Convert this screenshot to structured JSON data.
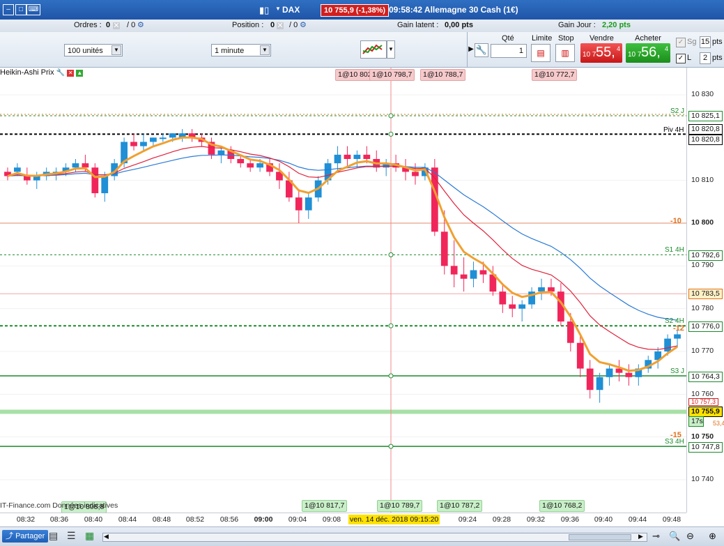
{
  "titlebar": {
    "instrument": "DAX",
    "price_badge": "10 755,9 (-1,38%)",
    "title": "09:58:42 Allemagne 30 Cash (1€)"
  },
  "statusbar": {
    "orders_label": "Ordres :",
    "orders_value": "0",
    "orders_sep": "/ 0",
    "position_label": "Position :",
    "position_value": "0",
    "position_sep": "/ 0",
    "gain_latent_label": "Gain latent :",
    "gain_latent_value": "0,00 pts",
    "gain_jour_label": "Gain Jour :",
    "gain_jour_value": "2,20 pts"
  },
  "toolbar": {
    "quantity_select": "100 unités",
    "interval_select": "1 minute",
    "qty_label": "Qté",
    "qty_value": "1",
    "limit_label": "Limite",
    "stop_label": "Stop",
    "sell_label": "Vendre",
    "buy_label": "Acheter",
    "sell_small": "10 7",
    "sell_big": "55,",
    "sell_sup": "4",
    "buy_small": "10 7",
    "buy_big": "56,",
    "buy_sup": "4",
    "sg_label": "Sg",
    "sg_value": "15",
    "sg_unit": "pts",
    "l_label": "L",
    "l_value": "2",
    "l_unit": "pts"
  },
  "chart": {
    "indicator_label": "Heikin-Ashi Prix",
    "copyright": "IT-Finance.com Données indicatives",
    "top_tags": [
      "1@10 802",
      "1@10 798,7",
      "1@10 788,7",
      "1@10 772,7"
    ],
    "bottom_tags": [
      "1@10 808,8",
      "1@10 817,7",
      "1@10 789,7",
      "1@10 787,2",
      "1@10 768,2"
    ],
    "right_labels": {
      "s2j": "S2 J",
      "piv4h": "Piv 4H",
      "m10": "-10",
      "s14h": "S1 4H",
      "s24h": "S2 4H",
      "m12": "-12",
      "s3j": "S3 J",
      "m15": "-15",
      "s34h": "S3 4H"
    }
  },
  "yaxis": {
    "ticks": [
      "10 830",
      "10 810",
      "10 800",
      "10 790",
      "10 780",
      "10 770",
      "10 760",
      "10 750",
      "10 740"
    ],
    "tags": [
      "10 825,1",
      "10 820,8",
      "10 820,8",
      "10 792,6",
      "10 783,5",
      "10 776,0",
      "10 764,3",
      "10 757,3",
      "10 755,9",
      "17s",
      "53,4",
      "10 747,8"
    ]
  },
  "xaxis": {
    "ticks": [
      "08:32",
      "08:36",
      "08:40",
      "08:44",
      "08:48",
      "08:52",
      "08:56",
      "09:00",
      "09:04",
      "09:08",
      "09:24",
      "09:28",
      "09:32",
      "09:36",
      "09:40",
      "09:44",
      "09:48"
    ],
    "cursor_label": "ven. 14 déc. 2018 09:15:20"
  },
  "bottombar": {
    "share_label": "Partager"
  },
  "colors": {
    "bull": "#1f8fd6",
    "bear": "#f0265a",
    "accent": "#2a6ad0",
    "resistance": "#c81e2e",
    "support": "#1a8a2a"
  },
  "chart_data": {
    "type": "candlestick",
    "indicator": "Heikin-Ashi Prix",
    "instrument": "DAX",
    "timeframe": "1 minute",
    "ylim": [
      10735,
      10833
    ],
    "x_ticks": [
      "08:32",
      "08:36",
      "08:40",
      "08:44",
      "08:48",
      "08:52",
      "08:56",
      "09:00",
      "09:04",
      "09:08",
      "09:24",
      "09:28",
      "09:32",
      "09:36",
      "09:40",
      "09:44",
      "09:48"
    ],
    "levels": [
      {
        "label": "S2 J",
        "value": 10825.1
      },
      {
        "label": "Piv 4H",
        "value": 10820.8
      },
      {
        "label": "-10",
        "value": 10800
      },
      {
        "label": "S1 4H",
        "value": 10792.6
      },
      {
        "label": "10 783,5",
        "value": 10783.5
      },
      {
        "label": "S2 4H",
        "value": 10776.0
      },
      {
        "label": "S3 J",
        "value": 10764.3
      },
      {
        "label": "10 755,9",
        "value": 10755.9
      },
      {
        "label": "S3 4H",
        "value": 10747.8
      }
    ],
    "candles": [
      [
        10812,
        10813,
        10810,
        10811
      ],
      [
        10812,
        10814,
        10811,
        10813
      ],
      [
        10811,
        10813,
        10809,
        10810
      ],
      [
        10810,
        10812,
        10808,
        10811
      ],
      [
        10811,
        10813,
        10810,
        10812
      ],
      [
        10812,
        10813,
        10810,
        10812
      ],
      [
        10812,
        10814,
        10811,
        10813
      ],
      [
        10813,
        10815,
        10812,
        10814
      ],
      [
        10814,
        10816,
        10812,
        10813
      ],
      [
        10813,
        10814,
        10806,
        10807
      ],
      [
        10807,
        10812,
        10805,
        10811
      ],
      [
        10811,
        10815,
        10810,
        10814
      ],
      [
        10814,
        10820,
        10813,
        10819
      ],
      [
        10819,
        10821,
        10817,
        10818
      ],
      [
        10818,
        10821,
        10817,
        10819
      ],
      [
        10819,
        10820,
        10818,
        10820
      ],
      [
        10820,
        10821,
        10819,
        10820
      ],
      [
        10820,
        10821,
        10819,
        10821
      ],
      [
        10820,
        10822,
        10819,
        10821
      ],
      [
        10821,
        10822,
        10819,
        10820
      ],
      [
        10820,
        10821,
        10818,
        10819
      ],
      [
        10819,
        10820,
        10815,
        10816
      ],
      [
        10816,
        10818,
        10814,
        10817
      ],
      [
        10817,
        10818,
        10814,
        10815
      ],
      [
        10815,
        10816,
        10813,
        10814
      ],
      [
        10814,
        10815,
        10812,
        10813
      ],
      [
        10813,
        10815,
        10812,
        10814
      ],
      [
        10814,
        10815,
        10811,
        10812
      ],
      [
        10812,
        10814,
        10808,
        10810
      ],
      [
        10810,
        10812,
        10805,
        10806
      ],
      [
        10806,
        10808,
        10800,
        10803
      ],
      [
        10803,
        10807,
        10801,
        10806
      ],
      [
        10806,
        10811,
        10805,
        10810
      ],
      [
        10810,
        10815,
        10809,
        10814
      ],
      [
        10814,
        10818,
        10812,
        10816
      ],
      [
        10816,
        10818,
        10813,
        10815
      ],
      [
        10815,
        10817,
        10813,
        10816
      ],
      [
        10816,
        10818,
        10814,
        10815
      ],
      [
        10815,
        10817,
        10812,
        10813
      ],
      [
        10813,
        10815,
        10811,
        10814
      ],
      [
        10814,
        10816,
        10812,
        10813
      ],
      [
        10813,
        10815,
        10810,
        10812
      ],
      [
        10812,
        10814,
        10809,
        10811
      ],
      [
        10811,
        10814,
        10810,
        10813
      ],
      [
        10813,
        10815,
        10797,
        10798
      ],
      [
        10798,
        10803,
        10788,
        10790
      ],
      [
        10790,
        10796,
        10785,
        10788
      ],
      [
        10788,
        10792,
        10784,
        10787
      ],
      [
        10787,
        10791,
        10785,
        10789
      ],
      [
        10789,
        10791,
        10786,
        10788
      ],
      [
        10788,
        10790,
        10783,
        10784
      ],
      [
        10784,
        10786,
        10779,
        10781
      ],
      [
        10781,
        10783,
        10778,
        10780
      ],
      [
        10780,
        10782,
        10777,
        10781
      ],
      [
        10781,
        10785,
        10780,
        10784
      ],
      [
        10784,
        10787,
        10782,
        10785
      ],
      [
        10785,
        10787,
        10783,
        10784
      ],
      [
        10784,
        10786,
        10776,
        10777
      ],
      [
        10777,
        10779,
        10770,
        10772
      ],
      [
        10772,
        10774,
        10764,
        10766
      ],
      [
        10766,
        10768,
        10759,
        10761
      ],
      [
        10761,
        10765,
        10758,
        10764
      ],
      [
        10764,
        10767,
        10762,
        10766
      ],
      [
        10766,
        10768,
        10763,
        10765
      ],
      [
        10765,
        10767,
        10762,
        10764
      ],
      [
        10764,
        10767,
        10762,
        10766
      ],
      [
        10766,
        10769,
        10765,
        10768
      ],
      [
        10768,
        10771,
        10766,
        10770
      ],
      [
        10770,
        10774,
        10769,
        10773
      ],
      [
        10773,
        10775,
        10771,
        10774
      ]
    ]
  }
}
